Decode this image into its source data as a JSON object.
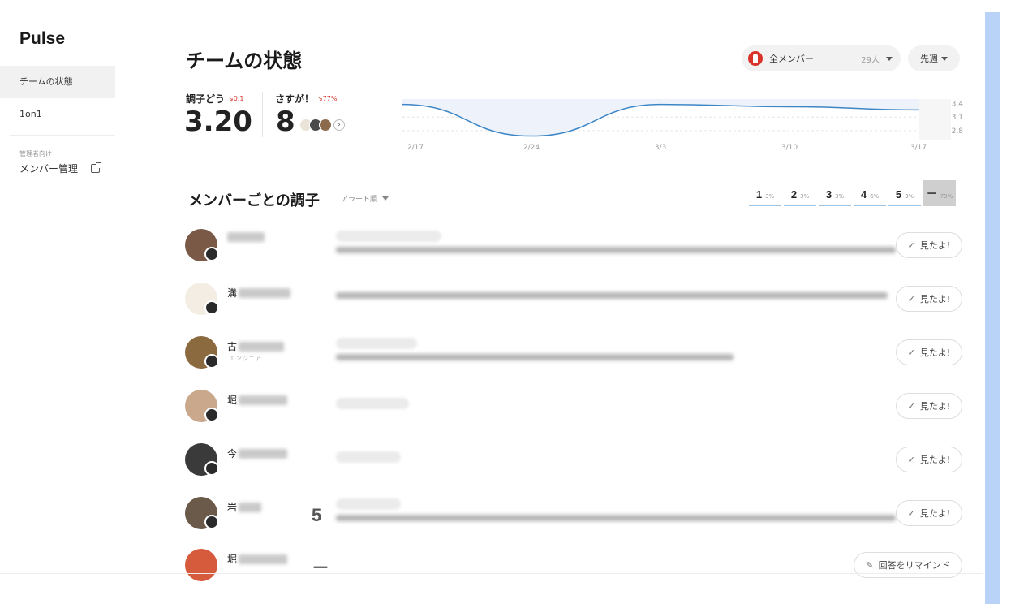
{
  "app": {
    "brand": "Pulse"
  },
  "sidebar": {
    "items": [
      {
        "label": "チームの状態",
        "active": true
      },
      {
        "label": "1on1",
        "active": false
      }
    ],
    "admin_caption": "管理者向け",
    "admin_link": "メンバー管理"
  },
  "header": {
    "title": "チームの状態",
    "member_filter": {
      "label": "全メンバー",
      "count": "29人"
    },
    "period_filter": {
      "label": "先週"
    }
  },
  "stats": {
    "condition": {
      "label": "調子どう",
      "delta": "↘0.1",
      "value": "3.20"
    },
    "kudos": {
      "label": "さすが！",
      "delta": "↘77%",
      "value": "8"
    }
  },
  "chart_data": {
    "type": "area",
    "x": [
      "2/17",
      "2/24",
      "3/3",
      "3/10",
      "3/17"
    ],
    "series": [
      {
        "values": [
          3.38,
          2.68,
          3.38,
          3.33,
          3.26
        ]
      }
    ],
    "y_ticks": [
      "3.4",
      "3.1",
      "2.8"
    ],
    "ylim": [
      2.6,
      3.5
    ],
    "line_color": "#3d86c6",
    "fill_color": "#eef3fb"
  },
  "section": {
    "title": "メンバーごとの調子",
    "sort_label": "アラート順",
    "distribution": [
      {
        "score": "1",
        "pct": "3%"
      },
      {
        "score": "2",
        "pct": "3%"
      },
      {
        "score": "3",
        "pct": "3%"
      },
      {
        "score": "4",
        "pct": "6%"
      },
      {
        "score": "5",
        "pct": "3%"
      },
      {
        "score": "－",
        "pct": "79%"
      }
    ]
  },
  "members": [
    {
      "name_prefix": "",
      "role": "",
      "score": "",
      "action": "見たよ!",
      "action_type": "check",
      "avatar_color": "#7a5a46"
    },
    {
      "name_prefix": "溝",
      "role": "",
      "score": "",
      "action": "見たよ!",
      "action_type": "check",
      "avatar_color": "#f4ede3"
    },
    {
      "name_prefix": "古",
      "role": "エンジニア",
      "score": "",
      "action": "見たよ!",
      "action_type": "check",
      "avatar_color": "#8a6a3e"
    },
    {
      "name_prefix": "堀",
      "role": "",
      "score": "",
      "action": "見たよ!",
      "action_type": "check",
      "avatar_color": "#c9a88c"
    },
    {
      "name_prefix": "今",
      "role": "",
      "score": "",
      "action": "見たよ!",
      "action_type": "check",
      "avatar_color": "#3a3a3a"
    },
    {
      "name_prefix": "岩",
      "role": "",
      "score": "5",
      "action": "見たよ!",
      "action_type": "check",
      "avatar_color": "#6b5a4a"
    },
    {
      "name_prefix": "堀",
      "role": "",
      "score": "－",
      "action": "回答をリマインド",
      "action_type": "remind",
      "avatar_color": "#d65a3c"
    }
  ]
}
